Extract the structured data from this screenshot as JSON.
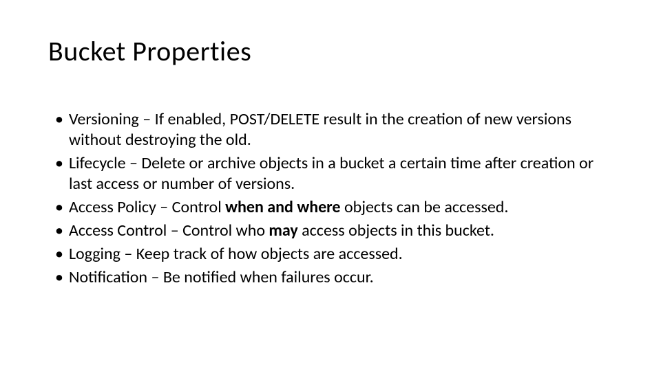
{
  "title": "Bucket Properties",
  "bullets": [
    {
      "pre": "Versioning – If enabled, POST/DELETE result in the creation of new versions without destroying the old.",
      "bold": "",
      "post": ""
    },
    {
      "pre": "Lifecycle – Delete or archive objects in a bucket a certain time after creation or last access or number of versions.",
      "bold": "",
      "post": ""
    },
    {
      "pre": "Access Policy – Control ",
      "bold": "when and where",
      "post": " objects can be accessed."
    },
    {
      "pre": "Access Control – Control who ",
      "bold": "may",
      "post": " access objects in this bucket."
    },
    {
      "pre": "Logging – Keep track of how objects are accessed.",
      "bold": "",
      "post": ""
    },
    {
      "pre": "Notification – Be notified when failures occur.",
      "bold": "",
      "post": ""
    }
  ]
}
